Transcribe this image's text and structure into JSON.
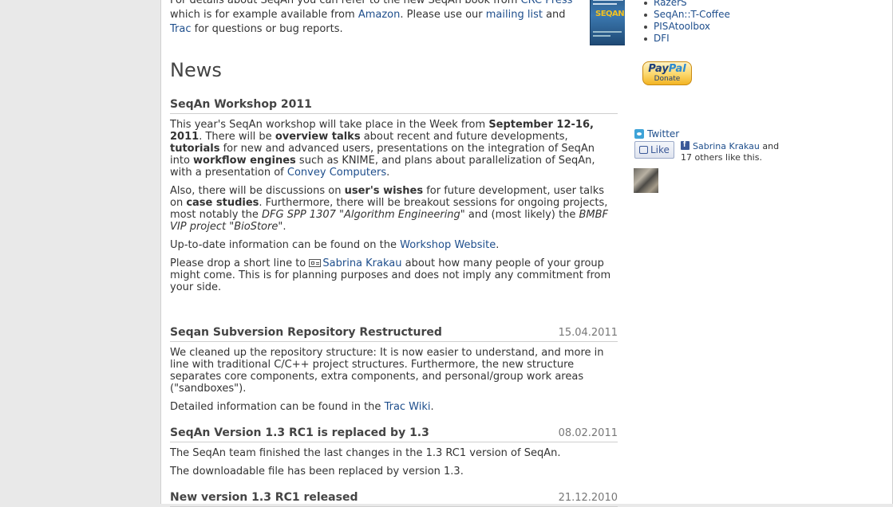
{
  "intro": {
    "text_1": "For details about SeqAn you can refer to the new SeqAn book from ",
    "link_crc": "CRC Press",
    "text_2": " which is for example available from ",
    "link_amazon": "Amazon",
    "text_3": ". Please use our ",
    "link_mailing": "mailing list",
    "text_4": " and ",
    "link_trac": "Trac",
    "text_5": " for questions or bug reports.",
    "book_logo": "SEQAN"
  },
  "news_heading": "News",
  "posts": [
    {
      "title": "SeqAn Workshop 2011",
      "date": "",
      "p1": {
        "a": "This year's SeqAn workshop will take place in the Week from ",
        "b1": "September 12-16, 2011",
        "c": ". There will be ",
        "b2": "overview talks",
        "d": " about recent and future developments, ",
        "b3": "tutorials",
        "e": " for new and advanced users, presentations on the integration of SeqAn into ",
        "b4": "workflow engines",
        "f": " such as KNIME, and plans about parallelization of SeqAn, with a presentation of ",
        "link": "Convey Computers",
        "g": "."
      },
      "p2": {
        "a": "Also, there will be discussions on ",
        "b1": "user's wishes",
        "c": " for future development, user talks on ",
        "b2": "case studies",
        "d": ". Furthermore, there will be breakout sessions for ongoing projects, most notably the ",
        "i1": "DFG SPP 1307 \"Algorithm Engineering\"",
        "e": " and (most likely) the ",
        "i2": "BMBF VIP project \"BioStore\"",
        "f": "."
      },
      "p3": {
        "a": "Up-to-date information can be found on the ",
        "link": "Workshop Website",
        "b": "."
      },
      "p4": {
        "a": "Please drop a short line to ",
        "link": "Sabrina Krakau",
        "b": " about how many people of your group might come. This is for planning purposes and does not imply any commitment from your side."
      }
    },
    {
      "title": "Seqan Subversion Repository Restructured",
      "date": "15.04.2011",
      "p1": "We cleaned up the repository structure: It is now easier to understand, and more in line with traditional C/C++ project structures. Furthermore, the new structure separates core components, extra components, and personal/group work areas (\"sandboxes\").",
      "p2": {
        "a": "Detailed information can be found in the ",
        "link": "Trac Wiki",
        "b": "."
      }
    },
    {
      "title": "SeqAn Version 1.3 RC1 is replaced by 1.3",
      "date": "08.02.2011",
      "p1": "The SeqAn team finished the last changes in the 1.3 RC1 version of SeqAn.",
      "p2": "The downloadable file has been replaced by version 1.3."
    },
    {
      "title": "New version 1.3 RC1 released",
      "date": "21.12.2010"
    }
  ],
  "sidebar": {
    "links": [
      "RazerS",
      "SeqAn::T-Coffee",
      "PISAtoolbox",
      "DFI"
    ],
    "paypal": {
      "brand_a": "Pay",
      "brand_b": "Pal",
      "label": "Donate"
    },
    "twitter_label": "Twitter",
    "like_label": "Like",
    "fb_name": "Sabrina Krakau",
    "fb_text": " and 17 others like this."
  },
  "colors": {
    "link": "#1e4e8c",
    "page_bg": "#e9e9e9"
  }
}
